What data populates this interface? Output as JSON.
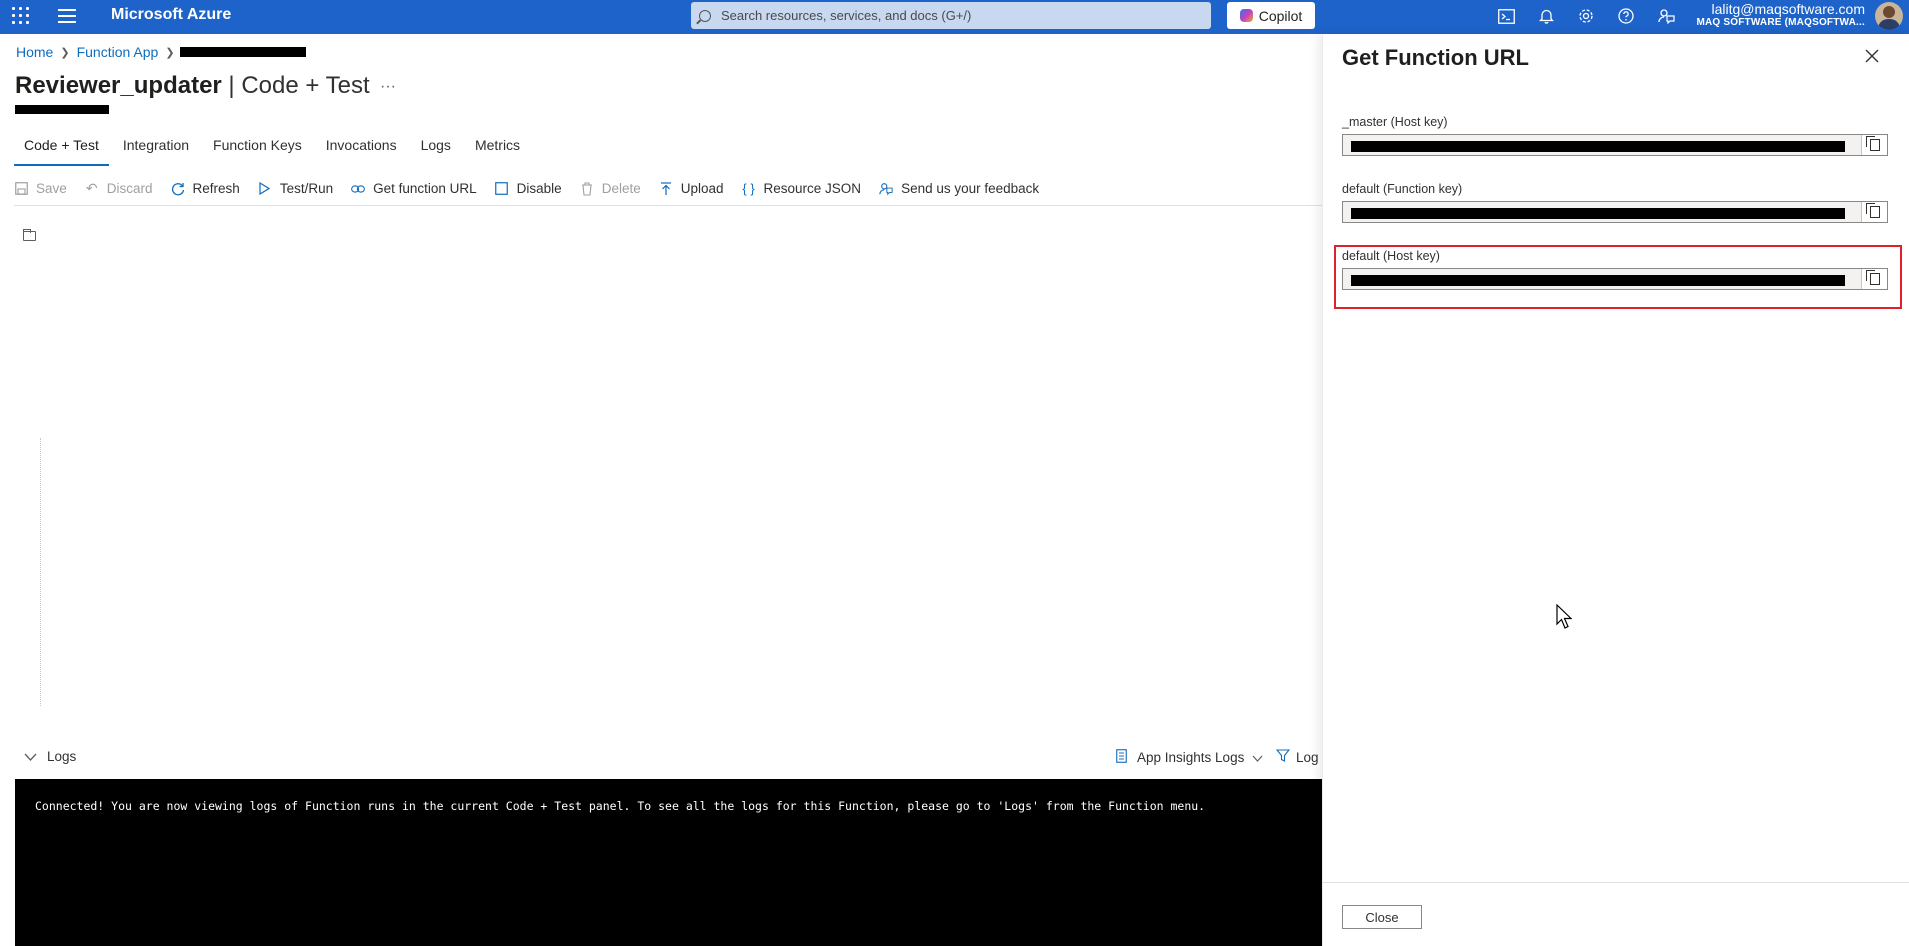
{
  "topbar": {
    "brand": "Microsoft Azure",
    "search_placeholder": "Search resources, services, and docs (G+/)",
    "copilot_label": "Copilot",
    "account_email": "lalitg@maqsoftware.com",
    "account_tenant": "MAQ SOFTWARE (MAQSOFTWA..."
  },
  "breadcrumb": {
    "home": "Home",
    "function_app": "Function App"
  },
  "page": {
    "title_bold": "Reviewer_updater",
    "title_rest": " | Code + Test",
    "more": "···"
  },
  "tabs": [
    "Code + Test",
    "Integration",
    "Function Keys",
    "Invocations",
    "Logs",
    "Metrics"
  ],
  "commands": {
    "save": "Save",
    "discard": "Discard",
    "refresh": "Refresh",
    "test_run": "Test/Run",
    "get_url": "Get function URL",
    "disable": "Disable",
    "delete": "Delete",
    "upload": "Upload",
    "resource_json": "Resource JSON",
    "feedback": "Send us your feedback"
  },
  "logs_bar": {
    "logs": "Logs",
    "app_insights": "App Insights Logs",
    "filter": "Log"
  },
  "console": {
    "message": "Connected! You are now viewing logs of Function runs in the current Code + Test panel. To see all the logs for this Function, please go to 'Logs' from the Function menu."
  },
  "panel": {
    "title": "Get Function URL",
    "fields": [
      {
        "label": "_master (Host key)"
      },
      {
        "label": "default (Function key)"
      },
      {
        "label": "default (Host key)"
      }
    ],
    "close_label": "Close"
  },
  "colors": {
    "topbar": "#1e63c9",
    "accent": "#0f6cbd",
    "highlight": "#e0202a"
  }
}
